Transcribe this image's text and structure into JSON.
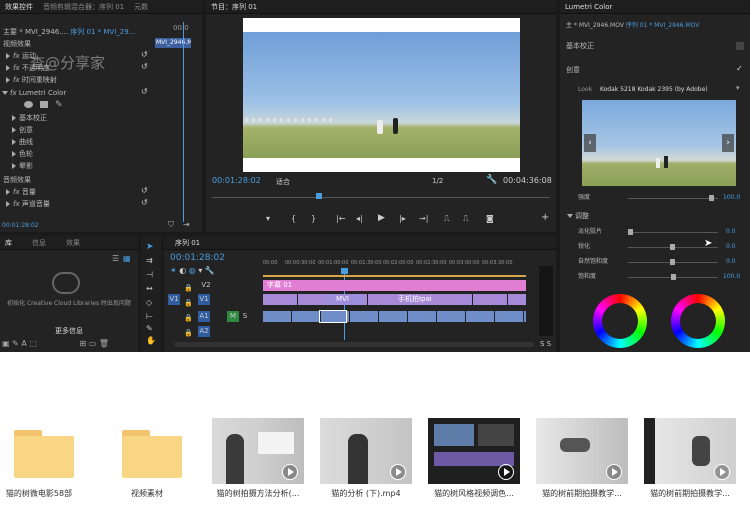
{
  "effect_controls": {
    "tabs": [
      "效果控件",
      "音频剪辑混合器：序列 01",
      "元数"
    ],
    "master": "主要 * MVI_2946....",
    "seq": "序列 01 * MVI_29...",
    "header_time": "00:0",
    "clip_label": "MVI_2946.M",
    "video_effects": "视频效果",
    "motion": "运动",
    "opacity": "不透明度",
    "time_remap": "时间重映射",
    "lumetri": "Lumetri Color",
    "basic": "基本校正",
    "creative": "创意",
    "curves": "曲线",
    "wheels": "色轮",
    "vignette": "晕影",
    "audio_effects": "音频效果",
    "volume": "音量",
    "channel_volume": "声道音量",
    "timecode": "00:01:28:02",
    "watermark": "查@分享家"
  },
  "program": {
    "title": "节目：序列 01",
    "timecode": "00:01:28:02",
    "fit": "适合",
    "scale": "1/2",
    "duration": "00:04:36:08"
  },
  "library": {
    "tabs": [
      "库",
      "信息",
      "效果"
    ],
    "message": "初始化 Creative Cloud Libraries 时出现问题",
    "more": "更多信息"
  },
  "timeline": {
    "title": "序列 01",
    "timecode": "00:01:28:02",
    "ruler": [
      "00:00",
      "00:00:30:00",
      "00:01:00:00",
      "00:01:30:00",
      "00:02:00:00",
      "00:02:30:00",
      "00:03:00:00",
      "00:03:30:00"
    ],
    "tracks": {
      "v2": "V2",
      "v1": "V1",
      "a1": "A1",
      "a2": "A2",
      "src_v1": "V1",
      "src_a1": "A1",
      "m": "M",
      "s": "S"
    },
    "caption_clip": "字幕 01",
    "clip_1": "MVI",
    "clip_2": "手机拍Ipai",
    "fx_label": "fx"
  },
  "lumetri": {
    "title": "Lumetri Color",
    "master": "主 * MVI_2946.MOV",
    "seq": "序列 01 * MVI_2946.MOV",
    "basic": "基本校正",
    "creative": "创意",
    "look_label": "Look",
    "look_value": "Kodak 5218 Kodak 2395 (by Adobe)",
    "intensity": "强度",
    "intensity_value": "100.0",
    "adjust": "调整",
    "faded_film": "淡化胶片",
    "faded_value": "0.0",
    "sharpen": "锐化",
    "sharpen_value": "0.0",
    "vibrance": "自然饱和度",
    "vibrance_value": "0.0",
    "saturation": "饱和度",
    "saturation_value": "100.0",
    "intensity_level": 0.95,
    "saturation_level": 0.5
  },
  "files": [
    {
      "name": "猫的树微电影58部",
      "type": "folder"
    },
    {
      "name": "视频素材",
      "type": "folder"
    },
    {
      "name": "猫的树拍摄方法分析(...",
      "type": "video"
    },
    {
      "name": "猫的分析 (下).mp4",
      "type": "video"
    },
    {
      "name": "猫的树风格视频调色...",
      "type": "video"
    },
    {
      "name": "猫的树前期拍摄教学...",
      "type": "video"
    },
    {
      "name": "猫的树前期拍摄教学...",
      "type": "video"
    }
  ],
  "colors": {
    "accent": "#4a9de0",
    "pink_clip": "#e07fd3",
    "blue_clip": "#6f8ec7",
    "folder": "#f9d683"
  }
}
